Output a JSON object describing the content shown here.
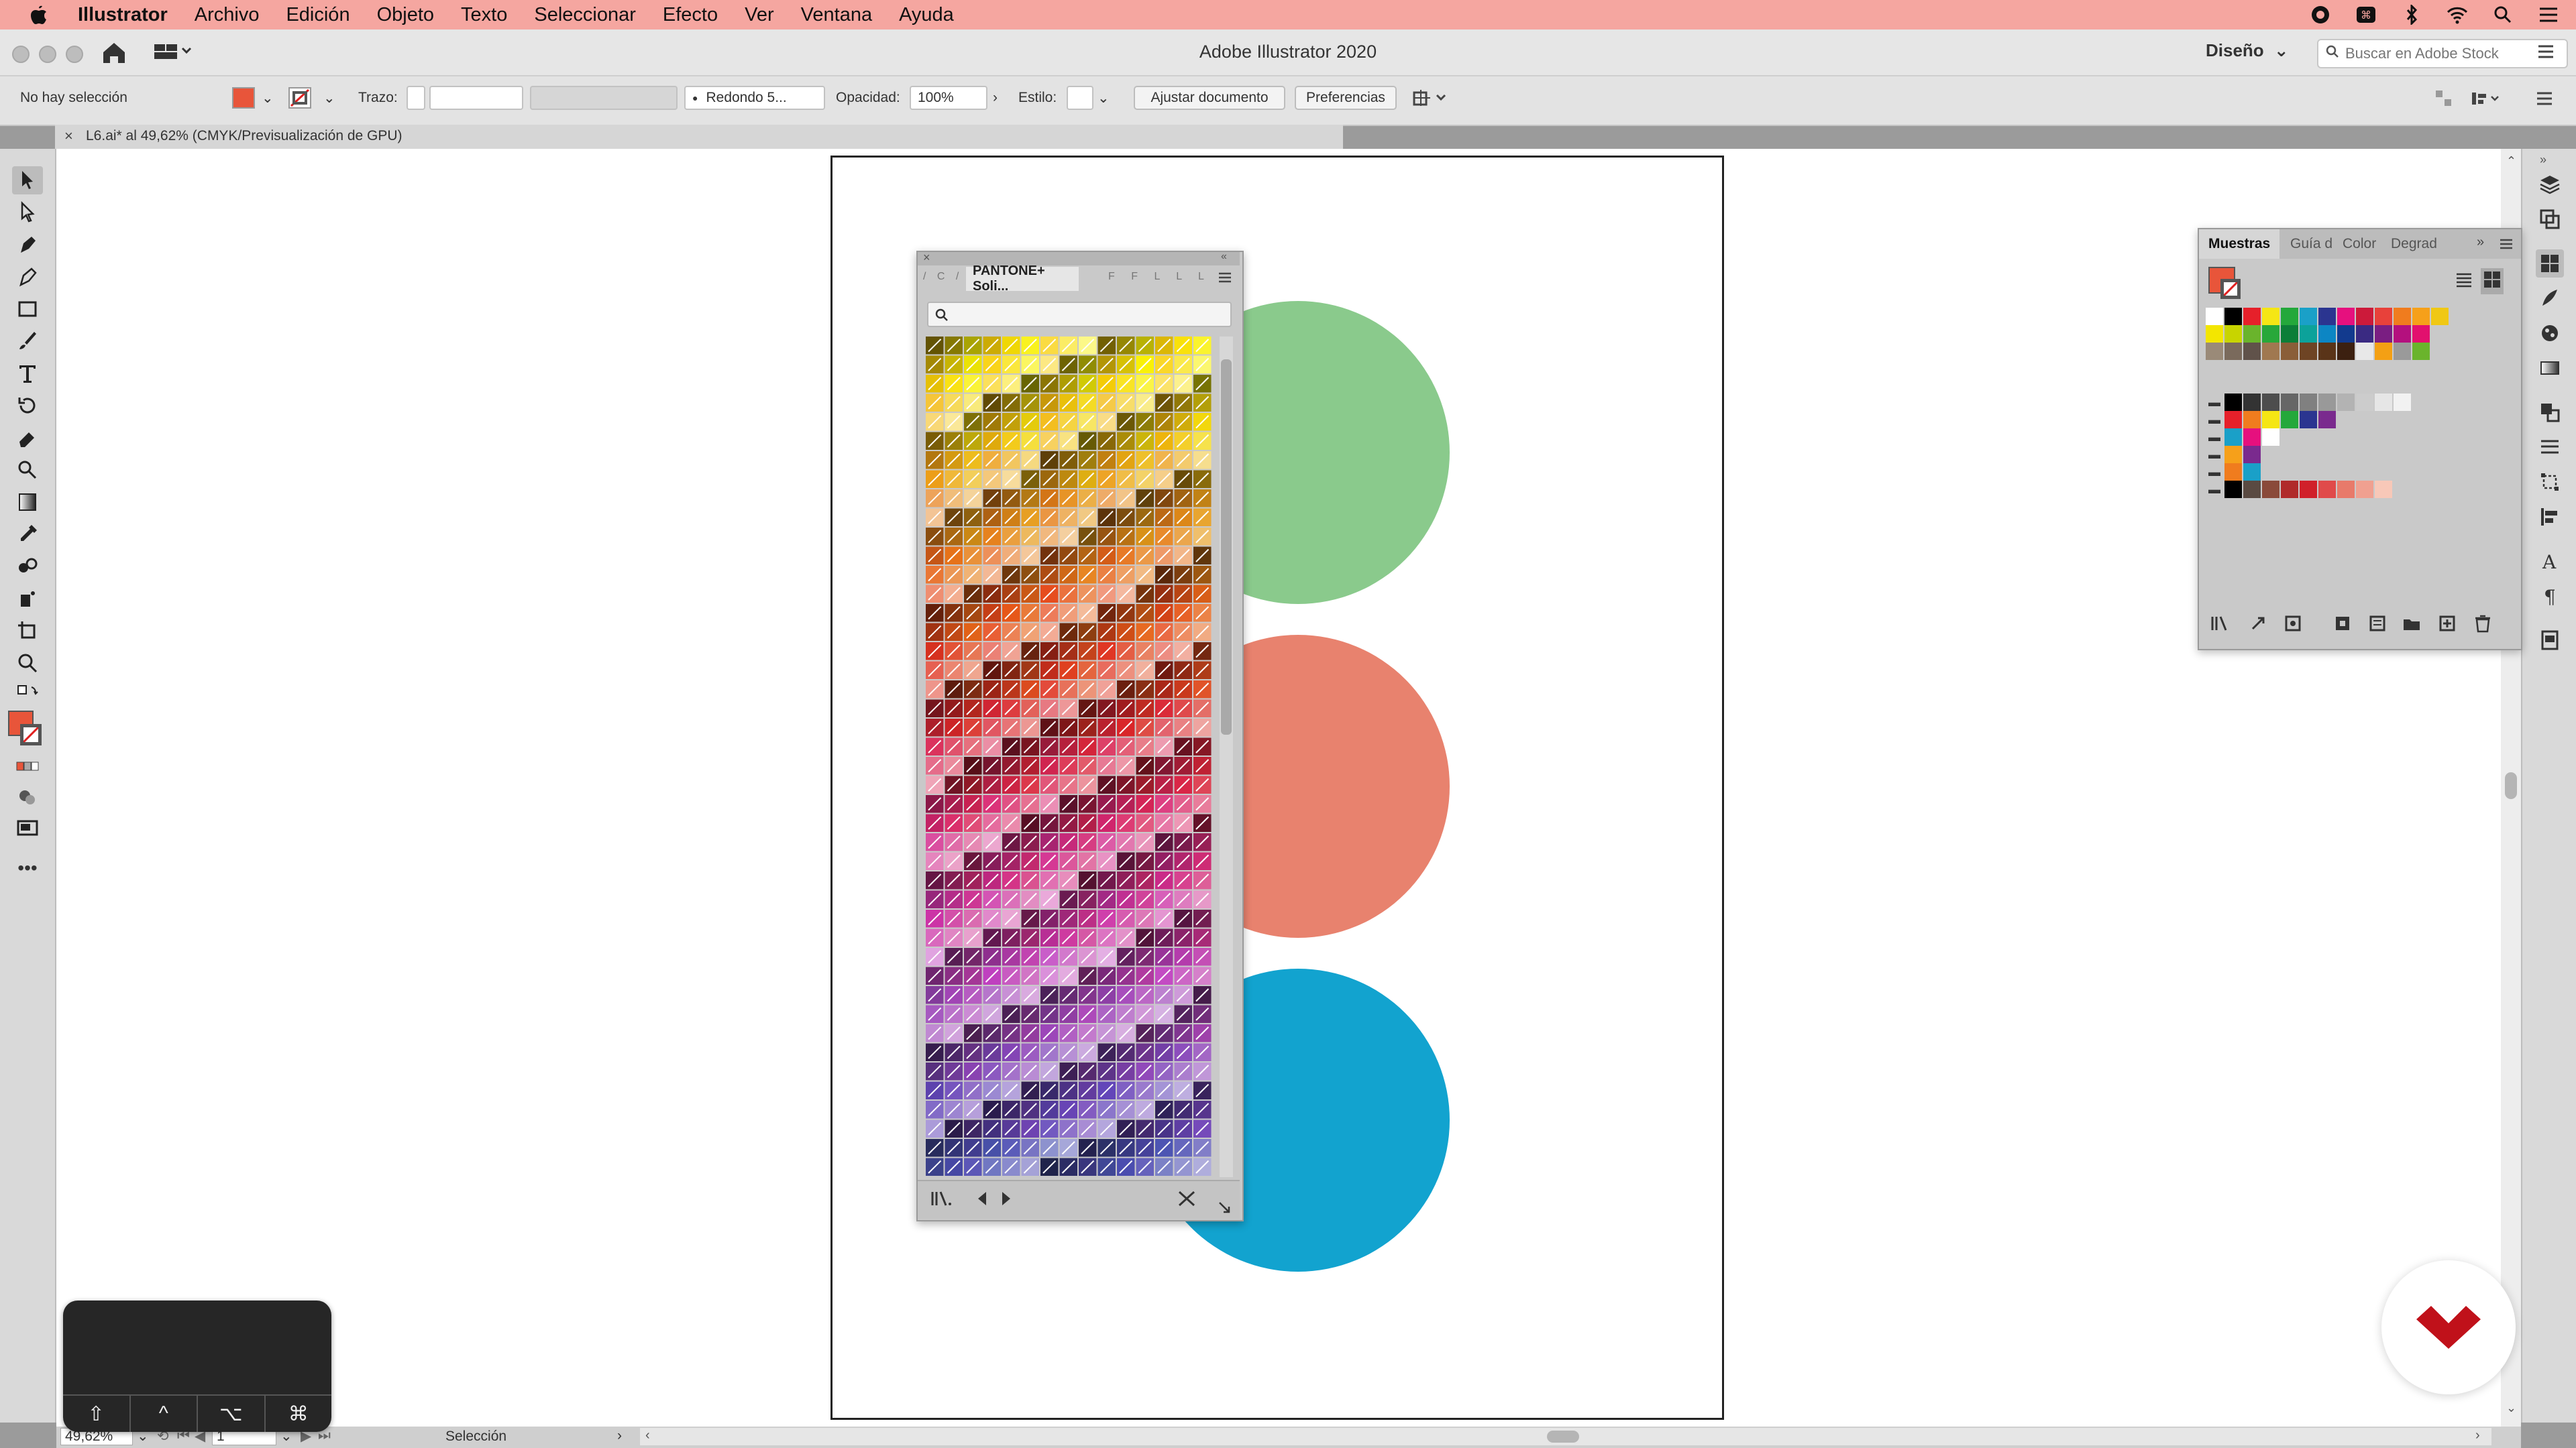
{
  "menubar": {
    "app_name": "Illustrator",
    "items": [
      "Archivo",
      "Edición",
      "Objeto",
      "Texto",
      "Seleccionar",
      "Efecto",
      "Ver",
      "Ventana",
      "Ayuda"
    ]
  },
  "appbar": {
    "title": "Adobe Illustrator 2020",
    "workspace": "Diseño",
    "stock_search_placeholder": "Buscar en Adobe Stock"
  },
  "controlbar": {
    "selection_status": "No hay selección",
    "stroke_label": "Trazo:",
    "brush_value": "Redondo 5...",
    "opacity_label": "Opacidad:",
    "opacity_value": "100%",
    "style_label": "Estilo:",
    "fit_document_button": "Ajustar documento",
    "preferences_button": "Preferencias"
  },
  "document": {
    "tab_label": "L6.ai* al 49,62% (CMYK/Previsualización de GPU)"
  },
  "statusbar": {
    "zoom": "49,62%",
    "artboard_number": "1",
    "tool_label": "Selección"
  },
  "pantone_panel": {
    "tab_label": "PANTONE+ Soli..."
  },
  "swatches_panel": {
    "tabs": [
      "Muestras",
      "Guía d",
      "Color",
      "Degrad"
    ]
  },
  "key_overlay": {
    "keys": [
      "⇧",
      "^",
      "⌥",
      "⌘"
    ]
  },
  "colors": {
    "fill_color": "#e8553a",
    "circle_green": "#8aca8c",
    "circle_salmon": "#e8826e",
    "circle_blue": "#12a3cf",
    "menubar_bg": "#f5a6a0",
    "logo_red": "#c0111a"
  },
  "swatches_rows": [
    [
      "#ffffff",
      "#000000",
      "#e6202a",
      "#f5e614",
      "#24a83b",
      "#1aa0c8",
      "#2b3590",
      "#e6107e",
      "#cc1a3a",
      "#e8413a",
      "#f07c1e",
      "#f6a01a",
      "#f0c814"
    ],
    [
      "#f3e600",
      "#c8d400",
      "#6ab42c",
      "#28a83a",
      "#0c7e38",
      "#0ca29a",
      "#0c86c4",
      "#123a8e",
      "#3a2a82",
      "#7a1e82",
      "#b4107e",
      "#e2106e"
    ],
    [
      "#9a8a78",
      "#7a6a5c",
      "#60524a",
      "#a07850",
      "#8a5e38",
      "#6e4424",
      "#5a3418",
      "#3c2010",
      "#e8e8e8",
      "#f4a014",
      "#9a9a9a",
      "#6ab42c"
    ],
    [
      "#000000",
      "#333333",
      "#4d4d4d",
      "#666666",
      "#808080",
      "#999999",
      "#b3b3b3",
      "#cccccc",
      "#e6e6e6",
      "#f2f2f2"
    ],
    [
      "#e6202a",
      "#f07c1e",
      "#f5e614",
      "#24a83b",
      "#2b3590",
      "#7a2a8e"
    ],
    [
      "#1aa0c8",
      "#e6107e",
      "#ffffff"
    ],
    [
      "#f6a01a",
      "#7a2a8e"
    ],
    [
      "#f07c1e",
      "#1aa0c8"
    ],
    [
      "#000000",
      "#5a4a42",
      "#8a4a3a",
      "#b02a2a",
      "#d0202a",
      "#e04a4a",
      "#e87a6a",
      "#f0a090",
      "#f8c8b8"
    ]
  ]
}
